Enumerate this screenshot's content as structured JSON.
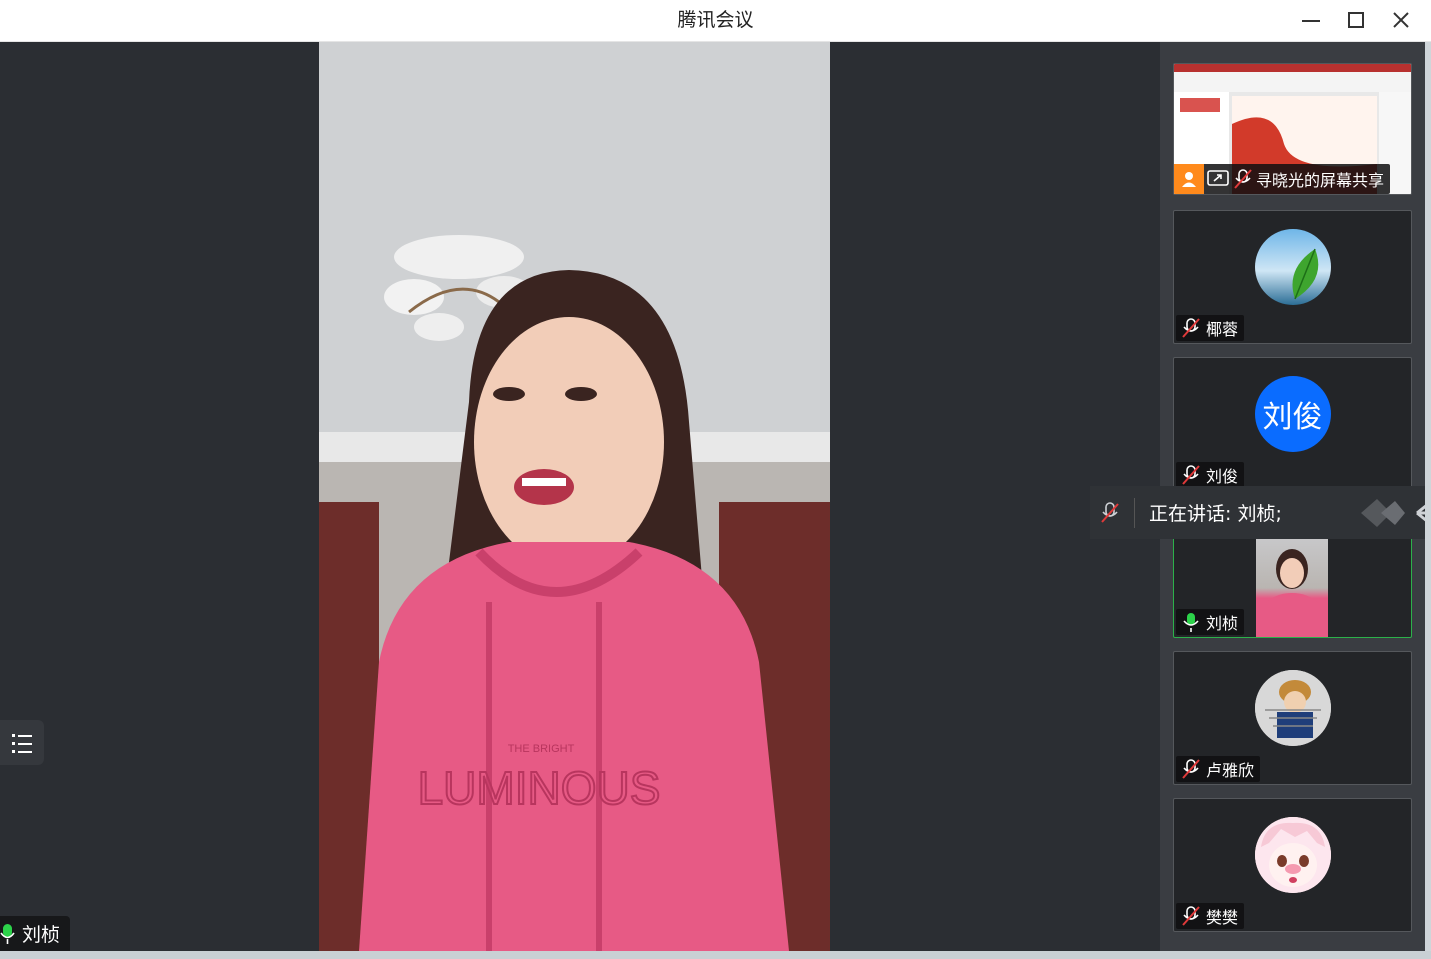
{
  "window": {
    "title": "腾讯会议"
  },
  "main": {
    "speaker_name": "刘桢",
    "hoodie_small": "THE BRIGHT",
    "hoodie_big": "LUMINOUS"
  },
  "participants": [
    {
      "name": "寻晓光的屏幕共享",
      "type": "screen-share",
      "muted": true
    },
    {
      "name": "椰蓉",
      "type": "avatar-image",
      "muted": true
    },
    {
      "name": "刘俊",
      "type": "avatar-text",
      "avatar_text": "刘俊",
      "muted": true
    },
    {
      "name": "刘桢",
      "type": "video",
      "muted": false,
      "active": true
    },
    {
      "name": "卢雅欣",
      "type": "avatar-image",
      "muted": true
    },
    {
      "name": "樊樊",
      "type": "avatar-image",
      "muted": true
    }
  ],
  "speaking_banner": {
    "text": "正在讲话: 刘桢;"
  },
  "colors": {
    "accent": "#0a6cff",
    "active_border": "#2cb14a",
    "mic_on": "#2cd34a",
    "mic_muted": "#e03a3a"
  }
}
